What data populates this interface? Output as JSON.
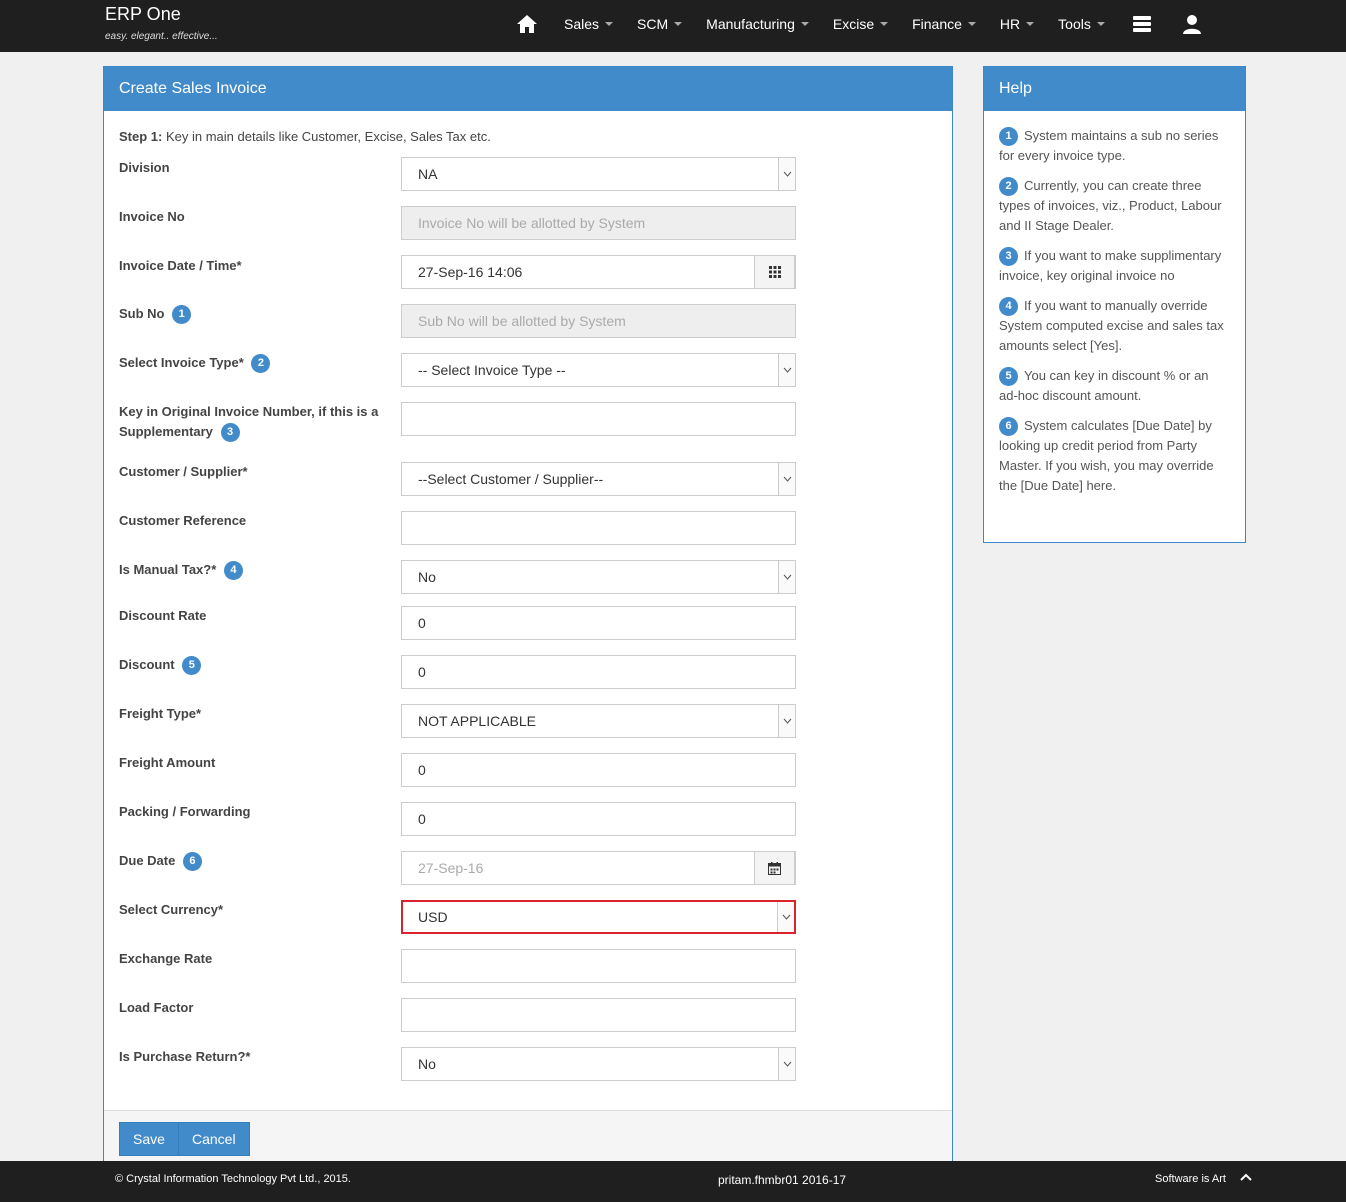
{
  "app": {
    "name": "ERP One",
    "tagline": "easy. elegant.. effective..."
  },
  "nav": {
    "home_icon": "home-icon",
    "items": [
      "Sales",
      "SCM",
      "Manufacturing",
      "Excise",
      "Finance",
      "HR",
      "Tools"
    ],
    "db_icon": "database-icon",
    "user_icon": "user-icon"
  },
  "form": {
    "title": "Create Sales Invoice",
    "step_label": "Step 1:",
    "step_text": " Key in main details like Customer, Excise, Sales Tax etc.",
    "fields": {
      "division": {
        "label": "Division",
        "value": "NA"
      },
      "invoice_no": {
        "label": "Invoice No",
        "placeholder": "Invoice No will be allotted by System"
      },
      "invoice_date": {
        "label": "Invoice Date / Time*",
        "value": "27-Sep-16 14:06"
      },
      "sub_no": {
        "label": "Sub No",
        "badge": "1",
        "placeholder": "Sub No will be allotted by System"
      },
      "invoice_type": {
        "label": "Select Invoice Type*",
        "badge": "2",
        "value": "-- Select Invoice Type --"
      },
      "original_invoice": {
        "label": "Key in Original Invoice Number, if this is a Supplementary",
        "badge": "3",
        "value": ""
      },
      "customer": {
        "label": "Customer / Supplier*",
        "value": "--Select Customer / Supplier--"
      },
      "customer_ref": {
        "label": "Customer Reference",
        "value": ""
      },
      "manual_tax": {
        "label": "Is Manual Tax?*",
        "badge": "4",
        "value": "No"
      },
      "discount_rate": {
        "label": "Discount Rate",
        "value": "0"
      },
      "discount": {
        "label": "Discount",
        "badge": "5",
        "value": "0"
      },
      "freight_type": {
        "label": "Freight Type*",
        "value": "NOT APPLICABLE"
      },
      "freight_amount": {
        "label": "Freight Amount",
        "value": "0"
      },
      "packing": {
        "label": "Packing / Forwarding",
        "value": "0"
      },
      "due_date": {
        "label": "Due Date",
        "badge": "6",
        "value": "27-Sep-16"
      },
      "currency": {
        "label": "Select Currency*",
        "value": "USD"
      },
      "exchange_rate": {
        "label": "Exchange Rate",
        "value": ""
      },
      "load_factor": {
        "label": "Load Factor",
        "value": ""
      },
      "purchase_return": {
        "label": "Is Purchase Return?*",
        "value": "No"
      }
    },
    "save_label": "Save",
    "cancel_label": "Cancel"
  },
  "help": {
    "title": "Help",
    "items": [
      {
        "num": "1",
        "text": "System maintains a sub no series for every invoice type."
      },
      {
        "num": "2",
        "text": "Currently, you can create three types of invoices, viz., Product, Labour and II Stage Dealer."
      },
      {
        "num": "3",
        "text": "If you want to make supplimentary invoice, key original invoice no"
      },
      {
        "num": "4",
        "text": "If you want to manually override System computed excise and sales tax amounts select [Yes]."
      },
      {
        "num": "5",
        "text": "You can key in discount % or an ad-hoc discount amount."
      },
      {
        "num": "6",
        "text": "System calculates [Due Date] by looking up credit period from Party Master. If you wish, you may override the [Due Date] here."
      }
    ]
  },
  "footer": {
    "copyright": "© Crystal Information Technology Pvt Ltd., 2015.",
    "user": "pritam.fhmbr01 2016-17",
    "slogan": "Software is Art"
  }
}
